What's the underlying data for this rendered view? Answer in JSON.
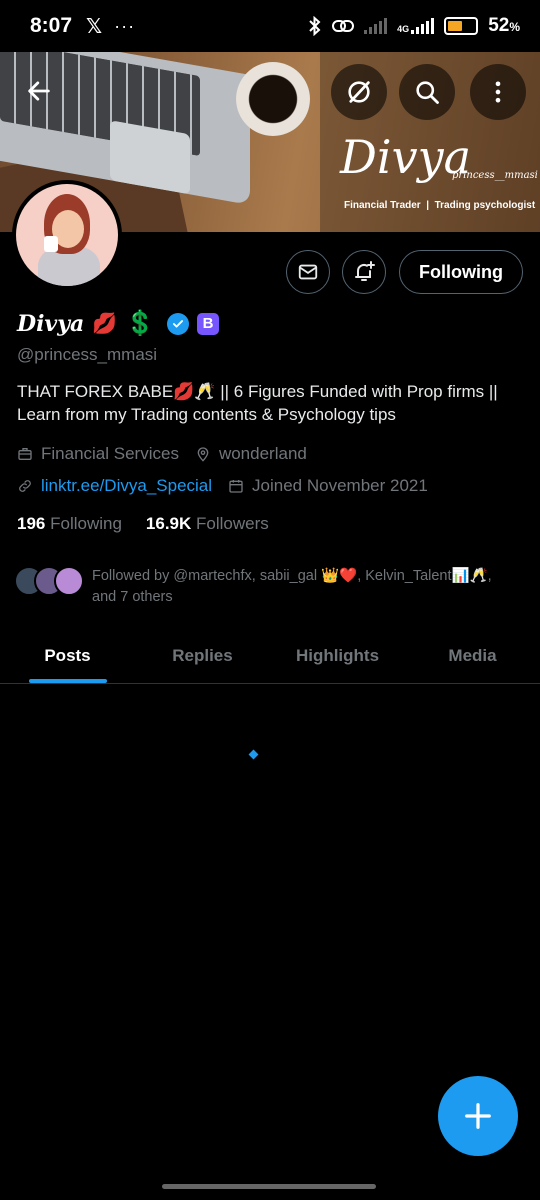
{
  "status_bar": {
    "time": "8:07",
    "x_logo": "𝕏",
    "more": "···",
    "network": "4G",
    "battery": "52",
    "battery_unit": "%"
  },
  "banner": {
    "signature": "Divya",
    "signature_handle": "princess__mmasi",
    "subtitle": "Financial Trader  |  Trading psychologist"
  },
  "actions": {
    "following_label": "Following"
  },
  "profile": {
    "name": "Divya",
    "name_emojis": [
      "💋",
      "💲"
    ],
    "badge_letter": "B",
    "handle": "@princess_mmasi",
    "bio": "THAT FOREX BABE💋🥂 || 6 Figures Funded with Prop firms || Learn from my Trading contents & Psychology tips",
    "category": "Financial Services",
    "location": "wonderland",
    "link": "linktr.ee/Divya_Special",
    "joined": "Joined November 2021",
    "following_count": "196",
    "following_label": "Following",
    "followers_count": "16.9K",
    "followers_label": "Followers",
    "followed_by": "Followed by @martechfx, sabii_gal 👑❤️, Kelvin_Talent📊🥂, and 7 others"
  },
  "tabs": [
    {
      "label": "Posts",
      "active": true
    },
    {
      "label": "Replies",
      "active": false
    },
    {
      "label": "Highlights",
      "active": false
    },
    {
      "label": "Media",
      "active": false
    }
  ],
  "colors": {
    "accent": "#1d9bf0",
    "background": "#000000",
    "muted": "#71767b",
    "badge": "#7856ff",
    "battery": "#f5a623"
  }
}
